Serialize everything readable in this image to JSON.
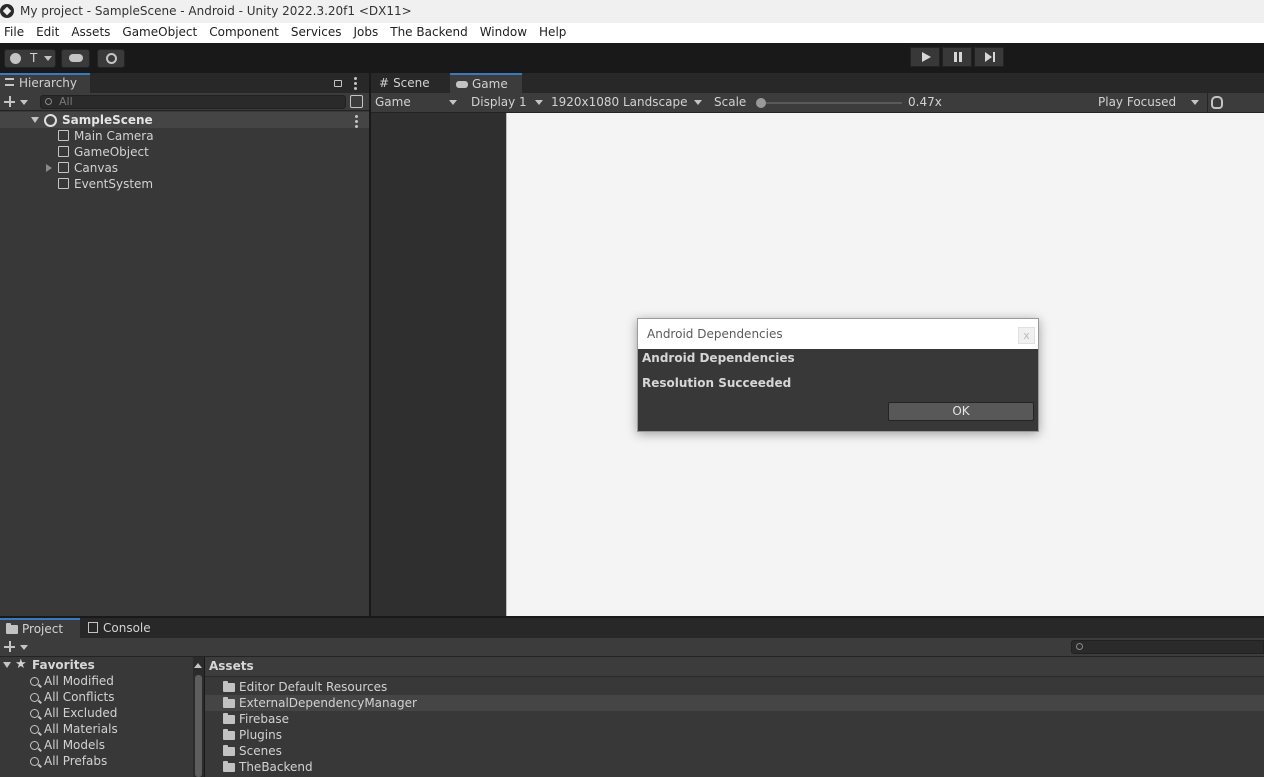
{
  "window": {
    "title": "My project - SampleScene - Android - Unity 2022.3.20f1 <DX11>"
  },
  "menu": [
    "File",
    "Edit",
    "Assets",
    "GameObject",
    "Component",
    "Services",
    "Jobs",
    "The Backend",
    "Window",
    "Help"
  ],
  "toolbar": {
    "account_label": "T"
  },
  "hierarchy": {
    "tab_label": "Hierarchy",
    "search_placeholder": "All",
    "scene_name": "SampleScene",
    "items": [
      "Main Camera",
      "GameObject",
      "Canvas",
      "EventSystem"
    ]
  },
  "game_view": {
    "tabs": [
      "Scene",
      "Game"
    ],
    "view_mode": "Game",
    "display": "Display 1",
    "resolution": "1920x1080 Landscape",
    "scale_label": "Scale",
    "scale_value": "0.47x",
    "scale_level": 0.0,
    "play_mode": "Play Focused"
  },
  "dialog": {
    "title": "Android Dependencies",
    "close_label": "x",
    "heading": "Android Dependencies",
    "message": "Resolution Succeeded",
    "ok_label": "OK"
  },
  "bottom": {
    "tabs": [
      "Project",
      "Console"
    ],
    "favorites_label": "Favorites",
    "favorites": [
      "All Modified",
      "All Conflicts",
      "All Excluded",
      "All Materials",
      "All Models",
      "All Prefabs"
    ],
    "assets_label": "Assets",
    "asset_folders": [
      "Editor Default Resources",
      "ExternalDependencyManager",
      "Firebase",
      "Plugins",
      "Scenes",
      "TheBackend"
    ],
    "selected_folder_index": 1
  },
  "colors": {
    "accent": "#3a79bb",
    "panel": "#383838",
    "selection_row": "#454545"
  }
}
